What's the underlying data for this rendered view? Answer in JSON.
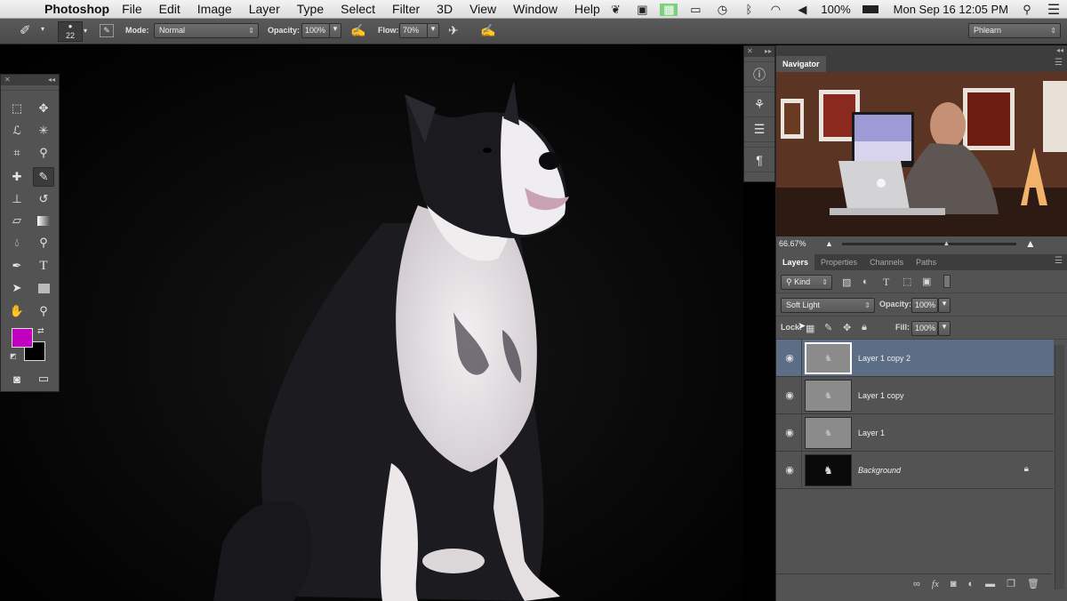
{
  "menubar": {
    "app_name": "Photoshop",
    "menus": [
      "File",
      "Edit",
      "Image",
      "Layer",
      "Type",
      "Select",
      "Filter",
      "3D",
      "View",
      "Window",
      "Help"
    ],
    "battery": "100%",
    "datetime": "Mon Sep 16  12:05 PM"
  },
  "options": {
    "brush_size": "22",
    "mode_label": "Mode:",
    "mode_value": "Normal",
    "opacity_label": "Opacity:",
    "opacity_value": "100%",
    "flow_label": "Flow:",
    "flow_value": "70%",
    "workspace": "Phlearn"
  },
  "navigator": {
    "tab": "Navigator",
    "zoom": "66.67%",
    "zoom_level": 0.6
  },
  "layers_panel": {
    "tabs": [
      "Layers",
      "Properties",
      "Channels",
      "Paths"
    ],
    "filter_kind": "Kind",
    "blend_mode": "Soft Light",
    "opacity_label": "Opacity:",
    "opacity_value": "100%",
    "lock_label": "Lock:",
    "fill_label": "Fill:",
    "fill_value": "100%",
    "layers": [
      {
        "name": "Layer 1 copy 2",
        "selected": true,
        "italic": false,
        "locked": false
      },
      {
        "name": "Layer 1 copy",
        "selected": false,
        "italic": false,
        "locked": false
      },
      {
        "name": "Layer 1",
        "selected": false,
        "italic": false,
        "locked": false
      },
      {
        "name": "Background",
        "selected": false,
        "italic": true,
        "locked": true
      }
    ]
  },
  "colors": {
    "foreground": "#c000c0",
    "background": "#000000",
    "selection": "#5c6d86"
  }
}
